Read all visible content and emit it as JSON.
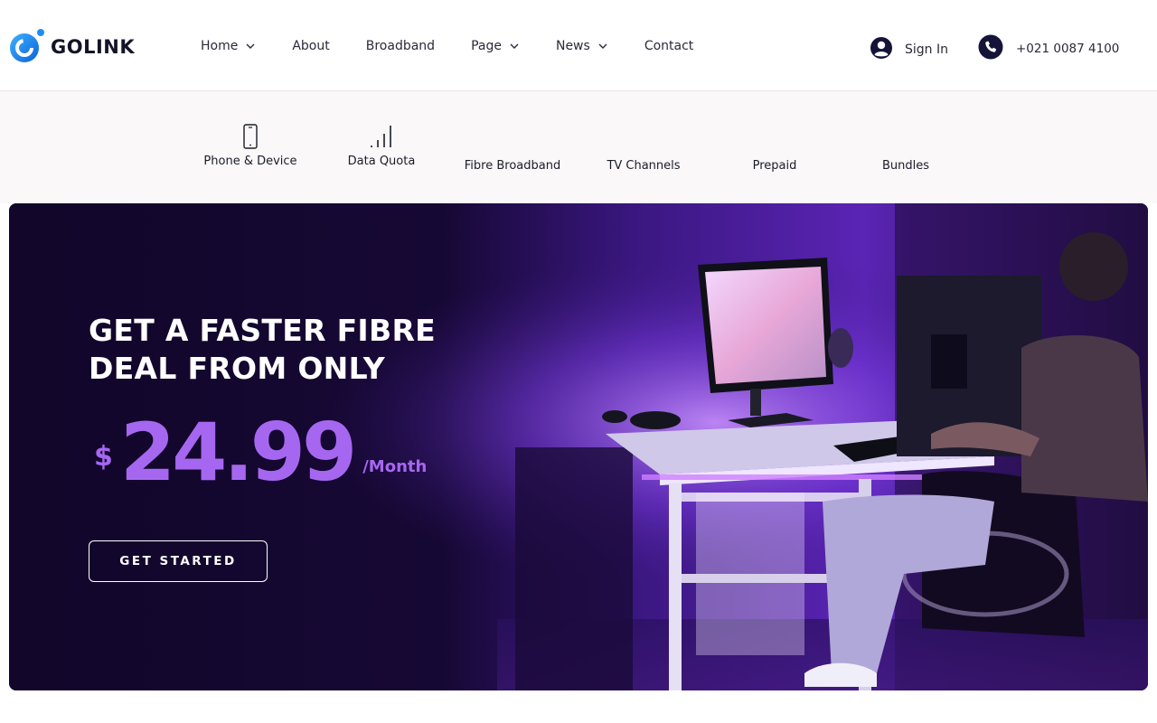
{
  "brand": {
    "name": "GOLINK",
    "accent": "#1e8ef0"
  },
  "nav": {
    "items": [
      {
        "label": "Home",
        "dropdown": true
      },
      {
        "label": "About",
        "dropdown": false
      },
      {
        "label": "Broadband",
        "dropdown": false
      },
      {
        "label": "Page",
        "dropdown": true
      },
      {
        "label": "News",
        "dropdown": true
      },
      {
        "label": "Contact",
        "dropdown": false
      }
    ],
    "sign_in": "Sign In",
    "phone": "+021 0087 4100"
  },
  "categories": [
    {
      "label": "Phone & Device",
      "icon": "smartphone-icon"
    },
    {
      "label": "Data Quota",
      "icon": "signal-bars-icon"
    },
    {
      "label": "Fibre Broadband",
      "icon": ""
    },
    {
      "label": "TV Channels",
      "icon": ""
    },
    {
      "label": "Prepaid",
      "icon": ""
    },
    {
      "label": "Bundles",
      "icon": ""
    }
  ],
  "hero": {
    "title_line1": "GET A FASTER FIBRE",
    "title_line2": "DEAL FROM ONLY",
    "currency": "$",
    "price": "24.99",
    "period": "/Month",
    "cta": "GET STARTED",
    "accent": "#a667f0",
    "background": "#12062a"
  }
}
